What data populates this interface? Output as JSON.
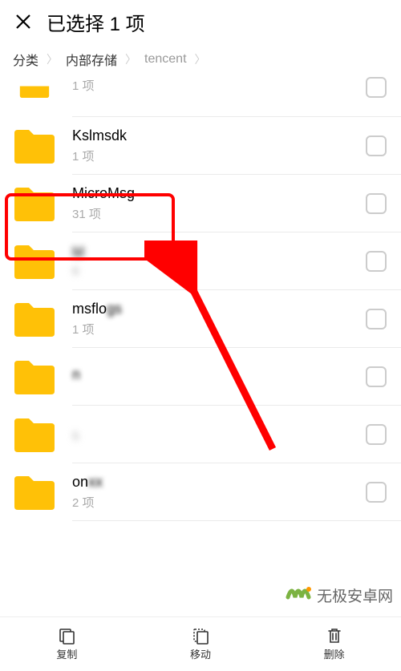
{
  "header": {
    "title": "已选择 1 项"
  },
  "breadcrumb": {
    "items": [
      "分类",
      "内部存储",
      "tencent"
    ]
  },
  "items": [
    {
      "name": "",
      "sub": "1 项"
    },
    {
      "name": "Kslmsdk",
      "sub": "1 项"
    },
    {
      "name": "MicroMsg",
      "sub": "31 项"
    },
    {
      "name": "M",
      "sub": "6"
    },
    {
      "name": "msflo",
      "sub": "1 项"
    },
    {
      "name": "n",
      "sub": ""
    },
    {
      "name": "",
      "sub": "5"
    },
    {
      "name": "on",
      "sub": "2 项"
    }
  ],
  "bottom": {
    "copy": "复制",
    "move": "移动",
    "delete": "删除"
  },
  "watermark": {
    "text": "无极安卓网"
  },
  "highlight": {
    "index": 2
  }
}
